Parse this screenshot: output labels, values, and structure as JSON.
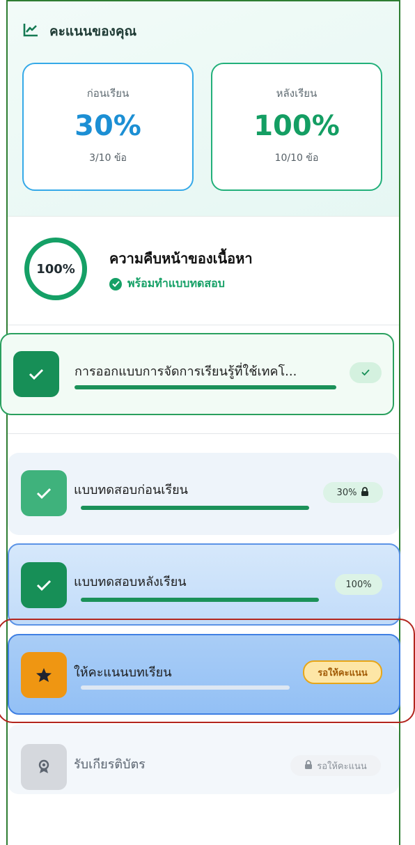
{
  "score": {
    "title": "คะแนนของคุณ",
    "icon": "line-chart-icon",
    "pre": {
      "label": "ก่อนเรียน",
      "percent": "30%",
      "count": "3/10 ข้อ"
    },
    "post": {
      "label": "หลังเรียน",
      "percent": "100%",
      "count": "10/10 ข้อ"
    }
  },
  "progress": {
    "ring_value": "100%",
    "title": "ความคืบหน้าของเนื้อหา",
    "status": "พร้อมทำแบบทดสอบ"
  },
  "lesson": {
    "title": "การออกแบบการจัดการเรียนรู้ที่ใช้เทคโ...",
    "status_icon": "check-icon",
    "progress": 1.0
  },
  "steps": [
    {
      "id": "pretest",
      "title": "แบบทดสอบก่อนเรียน",
      "badge": "30%",
      "badge_icon": "lock-icon",
      "icon": "check-icon",
      "progress": 1.0
    },
    {
      "id": "posttest",
      "title": "แบบทดสอบหลังเรียน",
      "badge": "100%",
      "icon": "check-icon",
      "progress": 1.0
    },
    {
      "id": "rate",
      "title": "ให้คะแนนบทเรียน",
      "badge": "รอให้คะแนน",
      "icon": "star-icon",
      "progress": 0.0
    },
    {
      "id": "certificate",
      "title": "รับเกียรติบัตร",
      "badge": "รอให้คะแนน",
      "badge_icon": "lock-icon",
      "icon": "award-icon",
      "progress": 0.0
    }
  ],
  "colors": {
    "accent_green": "#15a066",
    "pre_blue": "#1c8fd4",
    "post_green": "#149e63",
    "highlight_red": "#b3261e",
    "star_orange": "#f39c12"
  }
}
